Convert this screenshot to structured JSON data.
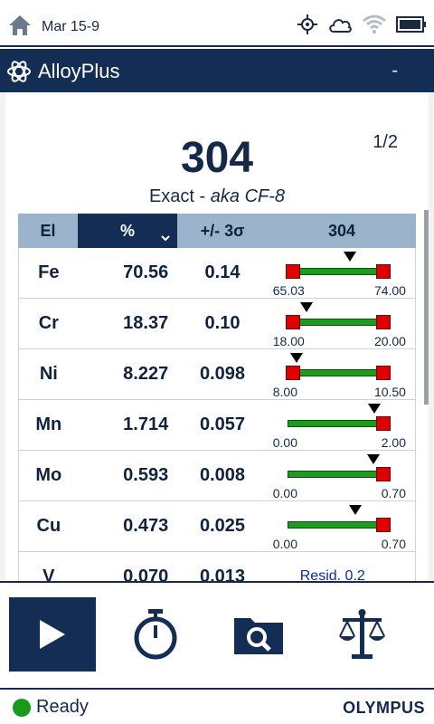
{
  "status_bar": {
    "date": "Mar 15-9",
    "icons": [
      "home-icon",
      "gps-icon",
      "cloud-icon",
      "wifi-icon",
      "battery-icon"
    ]
  },
  "app": {
    "title": "AlloyPlus",
    "menu": "-"
  },
  "result": {
    "grade": "304",
    "page": "1/2",
    "match_prefix": "Exact - ",
    "match_alias": "aka CF-8"
  },
  "table": {
    "headers": {
      "el": "El",
      "pct": "%",
      "sigma": "+/- 3σ",
      "grade": "304"
    },
    "rows": [
      {
        "el": "Fe",
        "pct": "70.56",
        "sigma": "0.14",
        "min": "65.03",
        "max": "74.00",
        "min_cap": true,
        "max_cap": true,
        "level": 0.62
      },
      {
        "el": "Cr",
        "pct": "18.37",
        "sigma": "0.10",
        "min": "18.00",
        "max": "20.00",
        "min_cap": true,
        "max_cap": true,
        "level": 0.19
      },
      {
        "el": "Ni",
        "pct": "8.227",
        "sigma": "0.098",
        "min": "8.00",
        "max": "10.50",
        "min_cap": true,
        "max_cap": true,
        "level": 0.09
      },
      {
        "el": "Mn",
        "pct": "1.714",
        "sigma": "0.057",
        "min": "0.00",
        "max": "2.00",
        "min_cap": false,
        "max_cap": true,
        "level": 0.857
      },
      {
        "el": "Mo",
        "pct": "0.593",
        "sigma": "0.008",
        "min": "0.00",
        "max": "0.70",
        "min_cap": false,
        "max_cap": true,
        "level": 0.847
      },
      {
        "el": "Cu",
        "pct": "0.473",
        "sigma": "0.025",
        "min": "0.00",
        "max": "0.70",
        "min_cap": false,
        "max_cap": true,
        "level": 0.676
      }
    ],
    "partial_row": {
      "el": "V",
      "pct": "0.070",
      "sigma": "0.013",
      "note": "Resid. 0.2"
    }
  },
  "nav": {
    "buttons": [
      "play-icon",
      "timer-icon",
      "folder-search-icon",
      "scale-icon"
    ]
  },
  "footer": {
    "status": "Ready",
    "brand": "OLYMPUS"
  },
  "colors": {
    "navy": "#142d55",
    "header_bg": "#9bb4cb",
    "bar_green": "#1e9a1e",
    "cap_red": "#e00000",
    "ready_green": "#1a9a1a"
  }
}
